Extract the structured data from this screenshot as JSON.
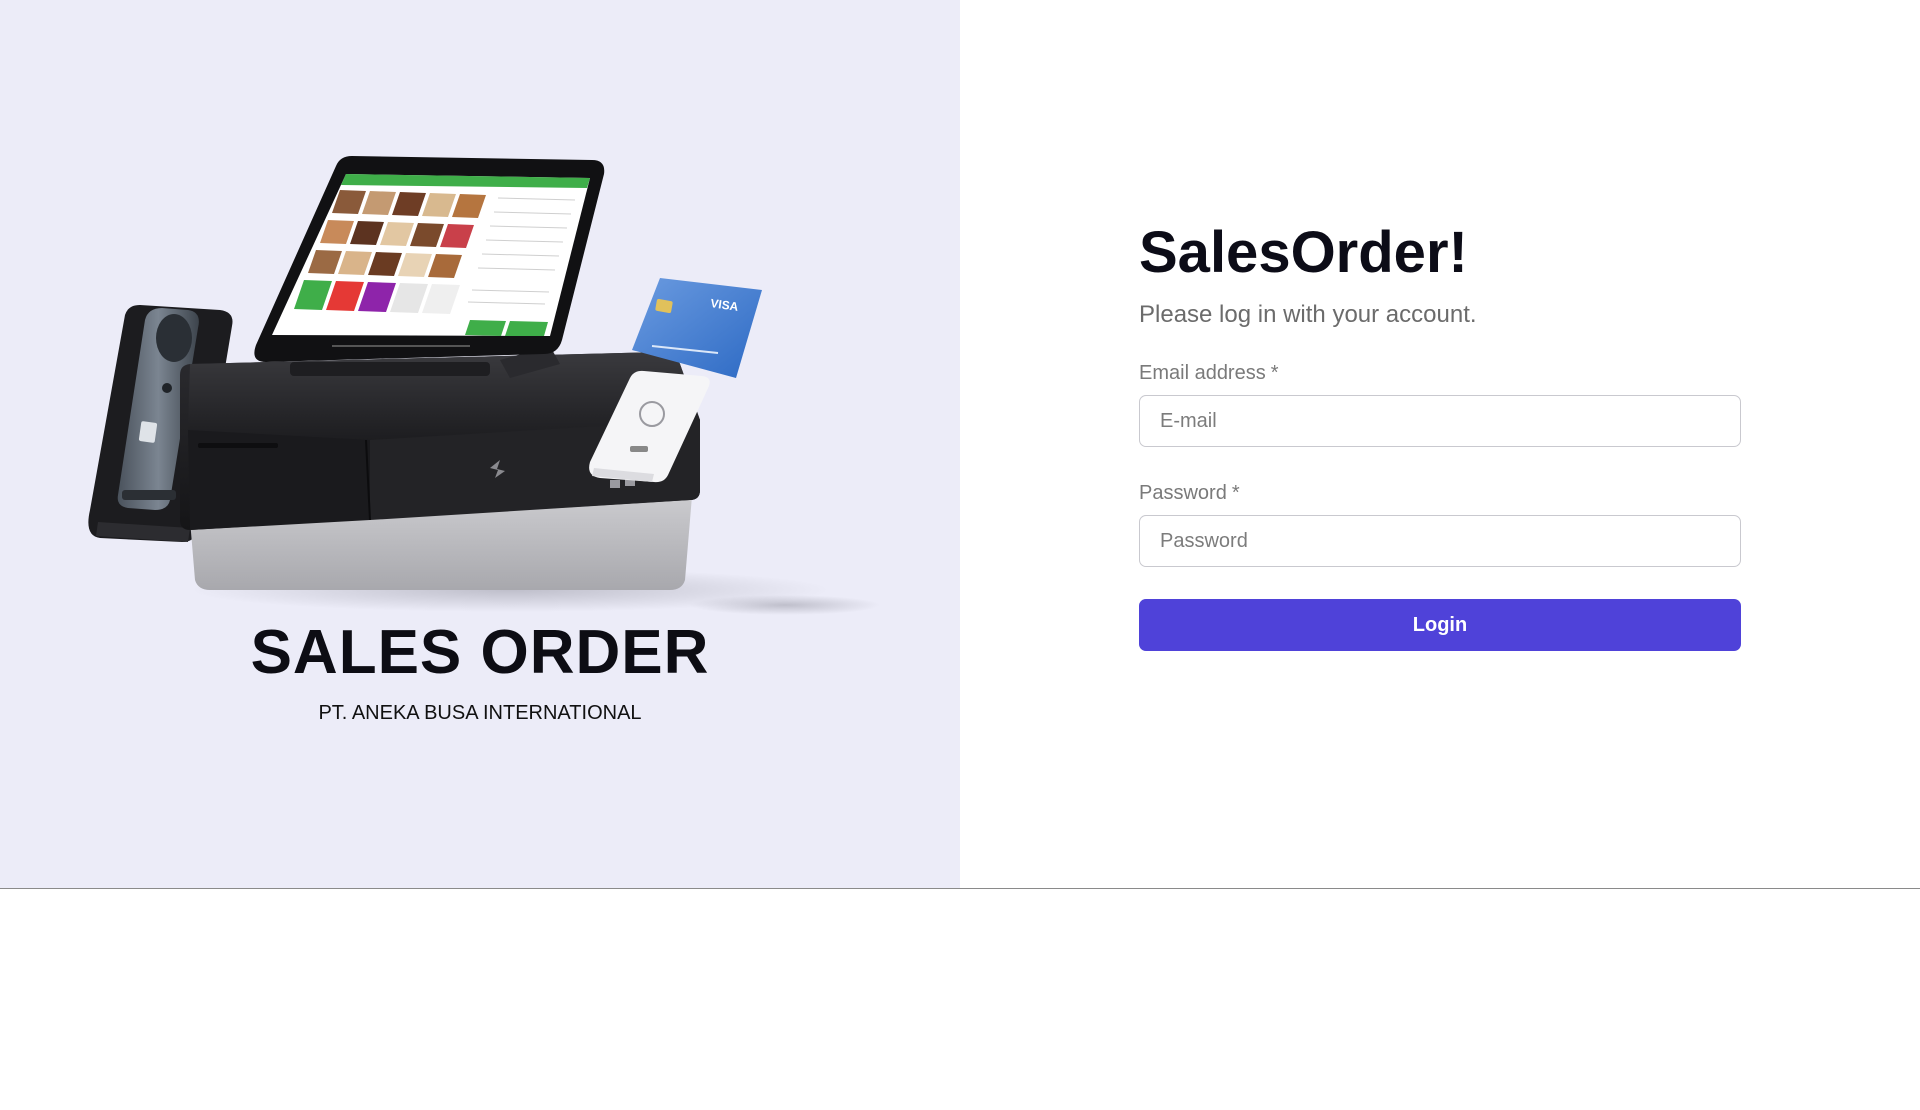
{
  "brand": {
    "title": "SALES ORDER",
    "company": "PT. ANEKA BUSA INTERNATIONAL",
    "illustration_name": "pos-terminal-illustration"
  },
  "login": {
    "title": "SalesOrder!",
    "subtitle": "Please log in with your account.",
    "email": {
      "label": "Email address",
      "required_marker": "*",
      "placeholder": "E-mail",
      "value": ""
    },
    "password": {
      "label": "Password",
      "required_marker": "*",
      "placeholder": "Password",
      "value": ""
    },
    "submit_label": "Login"
  },
  "colors": {
    "left_panel_bg": "#ececf8",
    "accent": "#4f42d9",
    "pos_green": "#3fae49"
  }
}
